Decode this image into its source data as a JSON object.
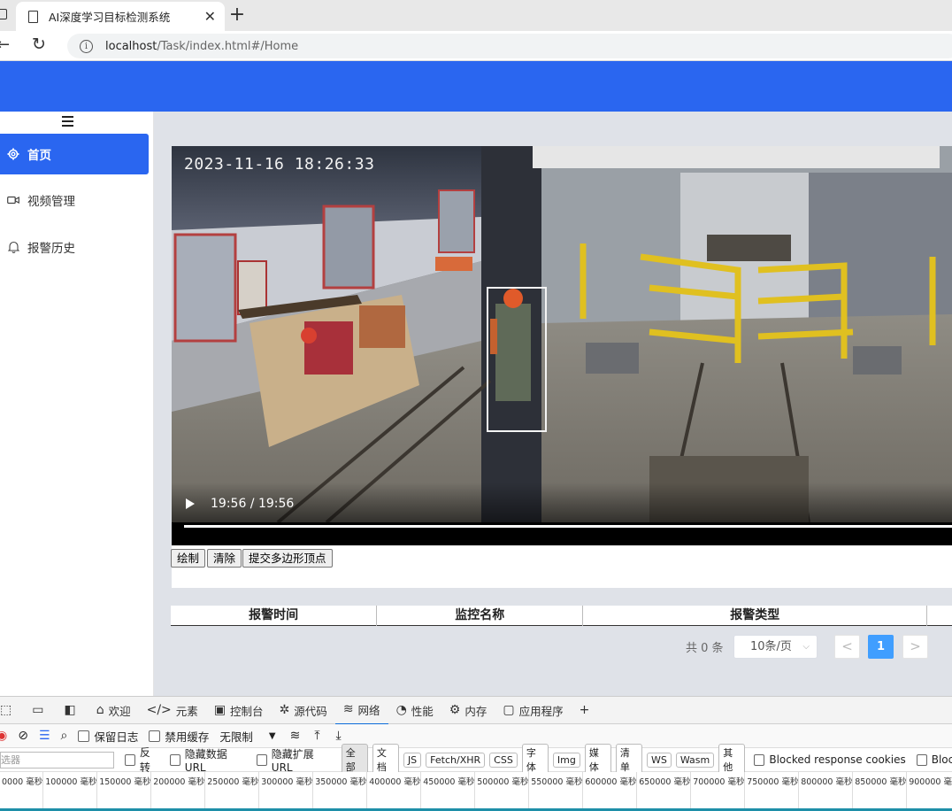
{
  "browser": {
    "tab_title": "AI深度学习目标检测系统",
    "url_host": "localhost",
    "url_path": "/Task/index.html#/Home"
  },
  "sidebar": {
    "items": [
      {
        "label": "首页",
        "icon": "gear-icon",
        "active": true
      },
      {
        "label": "视频管理",
        "icon": "video-camera-icon",
        "active": false
      },
      {
        "label": "报警历史",
        "icon": "bell-icon",
        "active": false
      }
    ]
  },
  "video": {
    "timestamp": "2023-11-16 18:26:33",
    "time_display": "19:56 / 19:56",
    "progress": 1.0
  },
  "toolbar": {
    "draw_label": "绘制",
    "clear_label": "清除",
    "submit_label": "提交多边形顶点"
  },
  "table": {
    "headers": [
      "报警时间",
      "监控名称",
      "报警类型"
    ]
  },
  "pagination": {
    "total": "共 0 条",
    "page_size": "10条/页",
    "current_page": "1",
    "prev": "<",
    "next": ">"
  },
  "devtools": {
    "tabs": [
      {
        "label": "欢迎",
        "icon": "home-icon"
      },
      {
        "label": "元素",
        "icon": "code-icon"
      },
      {
        "label": "控制台",
        "icon": "console-icon"
      },
      {
        "label": "源代码",
        "icon": "bug-icon"
      },
      {
        "label": "网络",
        "icon": "wifi-icon",
        "active": true
      },
      {
        "label": "性能",
        "icon": "gauge-icon"
      },
      {
        "label": "内存",
        "icon": "chip-icon"
      },
      {
        "label": "应用程序",
        "icon": "window-icon"
      }
    ],
    "preserve_log": "保留日志",
    "disable_cache": "禁用缓存",
    "throttling": "无限制",
    "filter_placeholder": "选器",
    "invert": "反转",
    "hide_data_url": "隐藏数据 URL",
    "hide_ext_url": "隐藏扩展 URL",
    "filters": [
      "全部",
      "文档",
      "JS",
      "Fetch/XHR",
      "CSS",
      "字体",
      "Img",
      "媒体",
      "清单",
      "WS",
      "Wasm",
      "其他"
    ],
    "blocked_cookies": "Blocked response cookies",
    "blocked_requests": "Bloc",
    "timeline_ticks": [
      "0000 毫秒",
      "100000 毫秒",
      "150000 毫秒",
      "200000 毫秒",
      "250000 毫秒",
      "300000 毫秒",
      "350000 毫秒",
      "400000 毫秒",
      "450000 毫秒",
      "500000 毫秒",
      "550000 毫秒",
      "600000 毫秒",
      "650000 毫秒",
      "700000 毫秒",
      "750000 毫秒",
      "800000 毫秒",
      "850000 毫秒",
      "900000 毫秒"
    ]
  },
  "colors": {
    "primary": "#2a66f0",
    "pager_active": "#409eff",
    "content_bg": "#dfe2e8"
  }
}
